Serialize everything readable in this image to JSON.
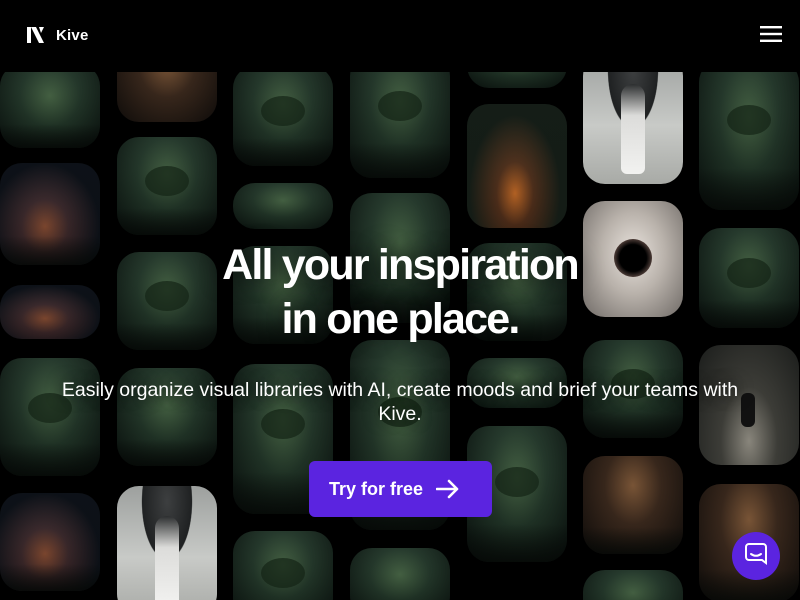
{
  "header": {
    "brand_name": "Kive",
    "logo_icon": "kive-logo-icon",
    "menu_icon": "hamburger-menu-icon"
  },
  "hero": {
    "headline_line1": "All your inspiration",
    "headline_line2": "in one place.",
    "subheadline": "Easily organize visual libraries with AI, create moods and brief your teams with Kive.",
    "cta_label": "Try for free",
    "cta_icon": "arrow-right-icon"
  },
  "chat": {
    "icon": "chat-bubble-icon"
  },
  "colors": {
    "background": "#000000",
    "accent": "#5b24e0",
    "text": "#ffffff"
  }
}
